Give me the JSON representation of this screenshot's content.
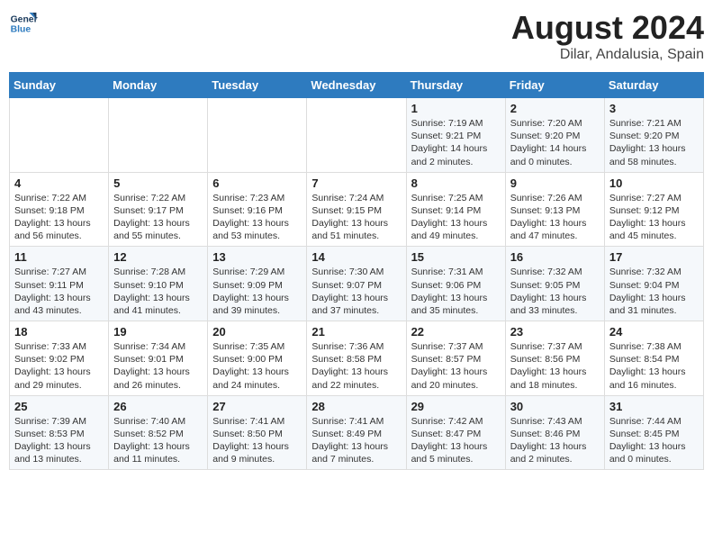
{
  "logo": {
    "line1": "General",
    "line2": "Blue"
  },
  "title": "August 2024",
  "location": "Dilar, Andalusia, Spain",
  "days_of_week": [
    "Sunday",
    "Monday",
    "Tuesday",
    "Wednesday",
    "Thursday",
    "Friday",
    "Saturday"
  ],
  "weeks": [
    [
      {
        "day": "",
        "content": ""
      },
      {
        "day": "",
        "content": ""
      },
      {
        "day": "",
        "content": ""
      },
      {
        "day": "",
        "content": ""
      },
      {
        "day": "1",
        "content": "Sunrise: 7:19 AM\nSunset: 9:21 PM\nDaylight: 14 hours\nand 2 minutes."
      },
      {
        "day": "2",
        "content": "Sunrise: 7:20 AM\nSunset: 9:20 PM\nDaylight: 14 hours\nand 0 minutes."
      },
      {
        "day": "3",
        "content": "Sunrise: 7:21 AM\nSunset: 9:20 PM\nDaylight: 13 hours\nand 58 minutes."
      }
    ],
    [
      {
        "day": "4",
        "content": "Sunrise: 7:22 AM\nSunset: 9:18 PM\nDaylight: 13 hours\nand 56 minutes."
      },
      {
        "day": "5",
        "content": "Sunrise: 7:22 AM\nSunset: 9:17 PM\nDaylight: 13 hours\nand 55 minutes."
      },
      {
        "day": "6",
        "content": "Sunrise: 7:23 AM\nSunset: 9:16 PM\nDaylight: 13 hours\nand 53 minutes."
      },
      {
        "day": "7",
        "content": "Sunrise: 7:24 AM\nSunset: 9:15 PM\nDaylight: 13 hours\nand 51 minutes."
      },
      {
        "day": "8",
        "content": "Sunrise: 7:25 AM\nSunset: 9:14 PM\nDaylight: 13 hours\nand 49 minutes."
      },
      {
        "day": "9",
        "content": "Sunrise: 7:26 AM\nSunset: 9:13 PM\nDaylight: 13 hours\nand 47 minutes."
      },
      {
        "day": "10",
        "content": "Sunrise: 7:27 AM\nSunset: 9:12 PM\nDaylight: 13 hours\nand 45 minutes."
      }
    ],
    [
      {
        "day": "11",
        "content": "Sunrise: 7:27 AM\nSunset: 9:11 PM\nDaylight: 13 hours\nand 43 minutes."
      },
      {
        "day": "12",
        "content": "Sunrise: 7:28 AM\nSunset: 9:10 PM\nDaylight: 13 hours\nand 41 minutes."
      },
      {
        "day": "13",
        "content": "Sunrise: 7:29 AM\nSunset: 9:09 PM\nDaylight: 13 hours\nand 39 minutes."
      },
      {
        "day": "14",
        "content": "Sunrise: 7:30 AM\nSunset: 9:07 PM\nDaylight: 13 hours\nand 37 minutes."
      },
      {
        "day": "15",
        "content": "Sunrise: 7:31 AM\nSunset: 9:06 PM\nDaylight: 13 hours\nand 35 minutes."
      },
      {
        "day": "16",
        "content": "Sunrise: 7:32 AM\nSunset: 9:05 PM\nDaylight: 13 hours\nand 33 minutes."
      },
      {
        "day": "17",
        "content": "Sunrise: 7:32 AM\nSunset: 9:04 PM\nDaylight: 13 hours\nand 31 minutes."
      }
    ],
    [
      {
        "day": "18",
        "content": "Sunrise: 7:33 AM\nSunset: 9:02 PM\nDaylight: 13 hours\nand 29 minutes."
      },
      {
        "day": "19",
        "content": "Sunrise: 7:34 AM\nSunset: 9:01 PM\nDaylight: 13 hours\nand 26 minutes."
      },
      {
        "day": "20",
        "content": "Sunrise: 7:35 AM\nSunset: 9:00 PM\nDaylight: 13 hours\nand 24 minutes."
      },
      {
        "day": "21",
        "content": "Sunrise: 7:36 AM\nSunset: 8:58 PM\nDaylight: 13 hours\nand 22 minutes."
      },
      {
        "day": "22",
        "content": "Sunrise: 7:37 AM\nSunset: 8:57 PM\nDaylight: 13 hours\nand 20 minutes."
      },
      {
        "day": "23",
        "content": "Sunrise: 7:37 AM\nSunset: 8:56 PM\nDaylight: 13 hours\nand 18 minutes."
      },
      {
        "day": "24",
        "content": "Sunrise: 7:38 AM\nSunset: 8:54 PM\nDaylight: 13 hours\nand 16 minutes."
      }
    ],
    [
      {
        "day": "25",
        "content": "Sunrise: 7:39 AM\nSunset: 8:53 PM\nDaylight: 13 hours\nand 13 minutes."
      },
      {
        "day": "26",
        "content": "Sunrise: 7:40 AM\nSunset: 8:52 PM\nDaylight: 13 hours\nand 11 minutes."
      },
      {
        "day": "27",
        "content": "Sunrise: 7:41 AM\nSunset: 8:50 PM\nDaylight: 13 hours\nand 9 minutes."
      },
      {
        "day": "28",
        "content": "Sunrise: 7:41 AM\nSunset: 8:49 PM\nDaylight: 13 hours\nand 7 minutes."
      },
      {
        "day": "29",
        "content": "Sunrise: 7:42 AM\nSunset: 8:47 PM\nDaylight: 13 hours\nand 5 minutes."
      },
      {
        "day": "30",
        "content": "Sunrise: 7:43 AM\nSunset: 8:46 PM\nDaylight: 13 hours\nand 2 minutes."
      },
      {
        "day": "31",
        "content": "Sunrise: 7:44 AM\nSunset: 8:45 PM\nDaylight: 13 hours\nand 0 minutes."
      }
    ]
  ]
}
